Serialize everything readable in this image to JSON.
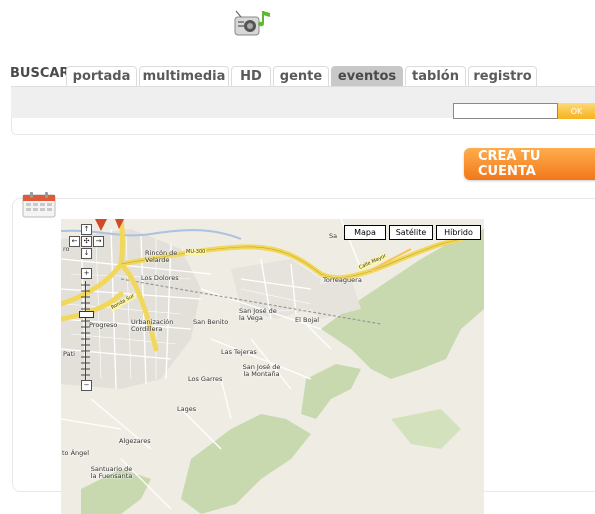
{
  "header": {
    "logo_icon": "radio-music-icon"
  },
  "nav": {
    "search_label": "BUSCAR",
    "tabs": [
      {
        "label": "portada"
      },
      {
        "label": "multimedia"
      },
      {
        "label": "HD"
      },
      {
        "label": "gente"
      },
      {
        "label": "eventos",
        "active": true
      },
      {
        "label": "tablón"
      },
      {
        "label": "registro"
      }
    ]
  },
  "search": {
    "value": "",
    "ok_label": "OK"
  },
  "cta": {
    "label": "CREA TU CUENTA",
    "color": "#f2781a"
  },
  "panel": {
    "icon": "calendar-icon"
  },
  "map": {
    "types": [
      "Mapa",
      "Satélite",
      "Híbrido"
    ],
    "controls": {
      "pan_up": "↑",
      "pan_left": "←",
      "pan_center": "✣",
      "pan_right": "→",
      "pan_down": "↓",
      "zoom_in": "+",
      "zoom_out": "−"
    },
    "places": [
      "Rincón de Velarde",
      "Los Dolores",
      "Urbanización Cordillera",
      "San Benito",
      "San José de la Vega",
      "El Bojal",
      "Torreaguera",
      "Las Tejeras",
      "San José de la Montaña",
      "Los Garres",
      "Lages",
      "Algezares",
      "Santuario de la Fuensanta",
      "Progreso",
      "Pati",
      "Sa",
      "to Ángel",
      "ro"
    ],
    "road_labels": [
      "MU-300",
      "Ronda Sur",
      "Calle Mayor"
    ]
  }
}
